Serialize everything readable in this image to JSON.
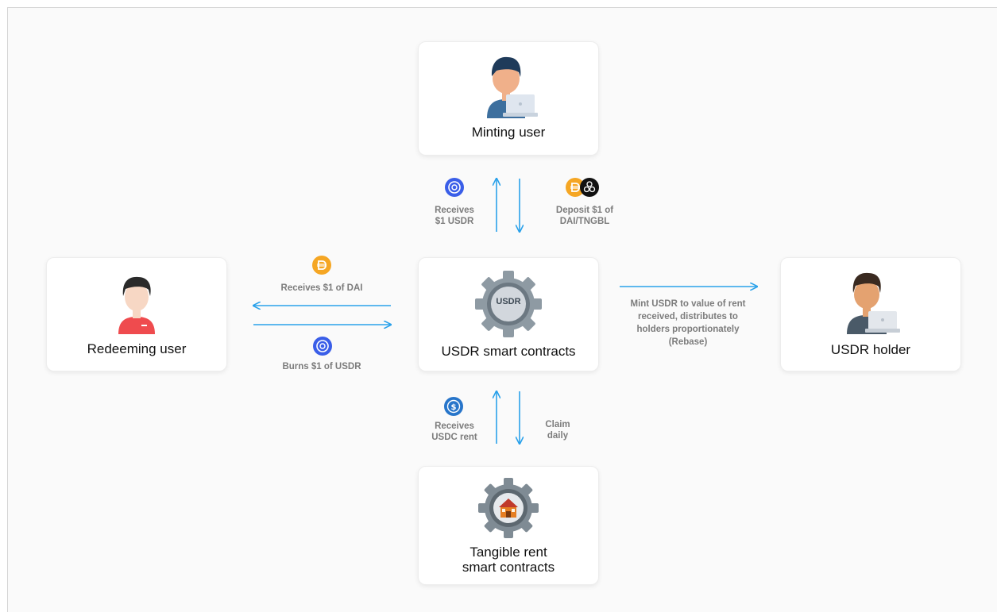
{
  "nodes": {
    "minting_user": "Minting user",
    "redeeming_user": "Redeeming user",
    "smart_contracts": "USDR smart contracts",
    "holder": "USDR holder",
    "rent_contracts_line1": "Tangible rent",
    "rent_contracts_line2": "smart contracts",
    "gear_badge": "USDR"
  },
  "flows": {
    "receives_usdr_line1": "Receives",
    "receives_usdr_line2": "$1 USDR",
    "deposit_line1": "Deposit $1 of",
    "deposit_line2": "DAI/TNGBL",
    "receives_dai": "Receives $1 of DAI",
    "burns_usdr": "Burns $1 of USDR",
    "mint_line1": "Mint USDR to value of rent",
    "mint_line2": "received, distributes to",
    "mint_line3": "holders proportionately",
    "mint_line4": "(Rebase)",
    "receives_usdc_line1": "Receives",
    "receives_usdc_line2": "USDC rent",
    "claim_line1": "Claim",
    "claim_line2": "daily"
  },
  "colors": {
    "arrow": "#2aa1ea",
    "usdr_coin": "#3a5ee8",
    "dai_coin": "#f5a623",
    "tngbl_coin": "#111111",
    "usdc_coin": "#2775ca",
    "gear": "#8e9aa3"
  }
}
